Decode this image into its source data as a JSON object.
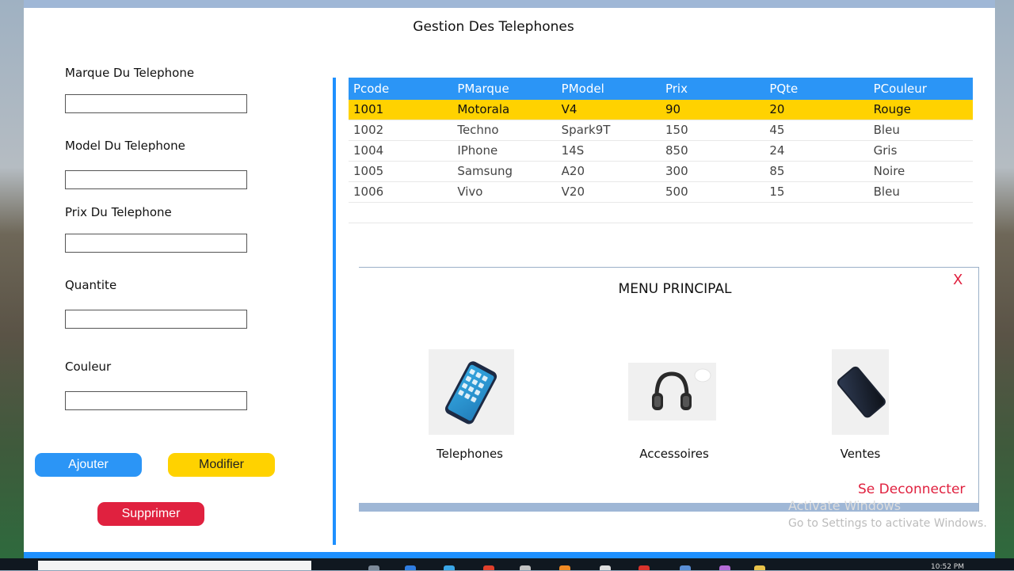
{
  "app": {
    "title": "Gestion Des Telephones"
  },
  "form": {
    "fields": [
      {
        "label": "Marque Du Telephone",
        "value": ""
      },
      {
        "label": "Model Du Telephone",
        "value": ""
      },
      {
        "label": "Prix Du Telephone",
        "value": ""
      },
      {
        "label": "Quantite",
        "value": ""
      },
      {
        "label": "Couleur",
        "value": ""
      }
    ]
  },
  "buttons": {
    "add": "Ajouter",
    "edit": "Modifier",
    "delete": "Supprimer"
  },
  "table": {
    "headers": [
      "Pcode",
      "PMarque",
      "PModel",
      "Prix",
      "PQte",
      "PCouleur"
    ],
    "rows": [
      [
        "1001",
        "Motorala",
        "V4",
        "90",
        "20",
        "Rouge"
      ],
      [
        "1002",
        "Techno",
        "Spark9T",
        "150",
        "45",
        "Bleu"
      ],
      [
        "1004",
        "IPhone",
        "14S",
        "850",
        "24",
        "Gris"
      ],
      [
        "1005",
        "Samsung",
        "A20",
        "300",
        "85",
        "Noire"
      ],
      [
        "1006",
        "Vivo",
        "V20",
        "500",
        "15",
        "Bleu"
      ]
    ],
    "selected_row": 0
  },
  "menu": {
    "title": "MENU PRINCIPAL",
    "close": "X",
    "tiles": [
      {
        "label": "Telephones",
        "icon": "smartphone-icon"
      },
      {
        "label": "Accessoires",
        "icon": "headphones-icon"
      },
      {
        "label": "Ventes",
        "icon": "phone-dark-icon"
      }
    ],
    "logout": "Se Deconnecter"
  },
  "watermark": {
    "line1": "Activate Windows",
    "line2": "Go to Settings to activate Windows."
  },
  "taskbar": {
    "clock": "10:52 PM"
  },
  "colors": {
    "accent_blue": "#2b95f6",
    "highlight_yellow": "#ffd200",
    "danger_red": "#e0213f"
  }
}
